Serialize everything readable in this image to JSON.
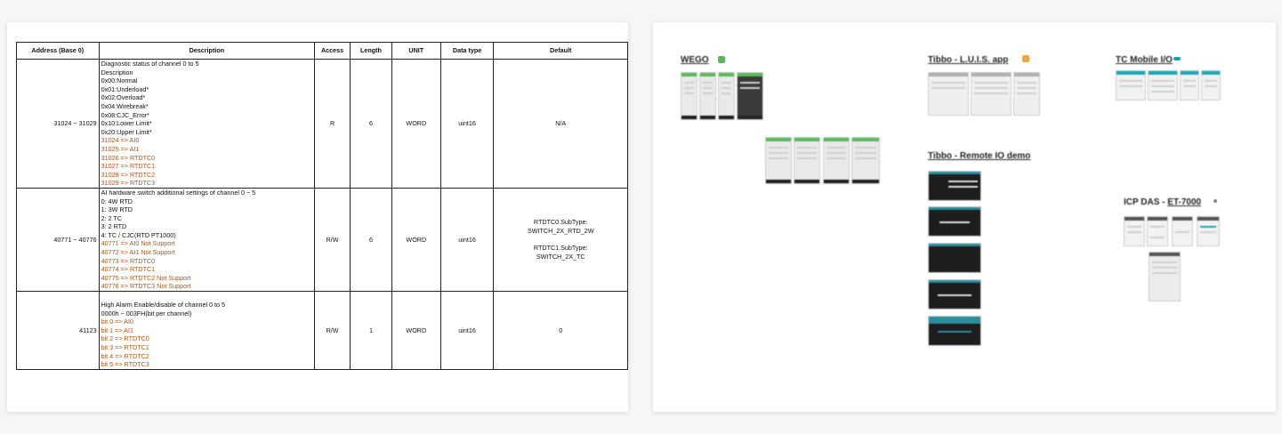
{
  "doc": {
    "headers": [
      "Address (Base 0)",
      "Description",
      "Access",
      "Length",
      "UNIT",
      "Data type",
      "Default"
    ],
    "rows": [
      {
        "address": "31024 ~ 31029",
        "desc": [
          {
            "t": "Diagnostic status of channel 0 to 5",
            "hl": false
          },
          {
            "t": "Description",
            "hl": false
          },
          {
            "t": "0x00:Normal",
            "hl": false
          },
          {
            "t": "0x01:Underload*",
            "hl": false
          },
          {
            "t": "0x02:Overload*",
            "hl": false
          },
          {
            "t": "0x04:Wirebreak*",
            "hl": false
          },
          {
            "t": "0x08:CJC_Error*",
            "hl": false
          },
          {
            "t": "0x10:Lower Limit*",
            "hl": false
          },
          {
            "t": "0x20:Upper Limit*",
            "hl": false
          },
          {
            "t": "31024 => AI0",
            "hl": true
          },
          {
            "t": "31025 => AI1",
            "hl": true
          },
          {
            "t": "31026 => RTDTC0",
            "hl": true
          },
          {
            "t": "31027 => RTDTC1",
            "hl": true
          },
          {
            "t": "31028 => RTDTC2",
            "hl": true
          },
          {
            "t": "31029 => RTDTC3",
            "hl": true
          }
        ],
        "access": "R",
        "length": "6",
        "unit": "WORD",
        "dtype": "uint16",
        "default": [
          "N/A"
        ]
      },
      {
        "address": "40771 ~ 40776",
        "desc": [
          {
            "t": "AI hardware switch additional settings of channel 0 ~ 5",
            "hl": false
          },
          {
            "t": "0: 4W RTD",
            "hl": false
          },
          {
            "t": "1: 3W RTD",
            "hl": false
          },
          {
            "t": "2: 2 TC",
            "hl": false
          },
          {
            "t": "3: 2 RTD",
            "hl": false
          },
          {
            "t": "4: TC / CJC(RTD PT1000)",
            "hl": false
          },
          {
            "t": "40771 => AI0 Not Support",
            "hl": true
          },
          {
            "t": "40772 => AI1 Not Support",
            "hl": true
          },
          {
            "t": "40773 => RTDTC0",
            "hl": true
          },
          {
            "t": "40774 => RTDTC1",
            "hl": true
          },
          {
            "t": "40775 => RTDTC2 Not Support",
            "hl": true
          },
          {
            "t": "40776 => RTDTC3 Not Support",
            "hl": true
          }
        ],
        "access": "R/W",
        "length": "6",
        "unit": "WORD",
        "dtype": "uint16",
        "default": [
          "RTDTC0.SubType:",
          "SWITCH_2X_RTD_2W",
          "",
          "RTDTC1.SubType:",
          "SWITCH_2X_TC"
        ]
      },
      {
        "address": "41123",
        "desc": [
          {
            "t": "",
            "hl": false
          },
          {
            "t": "High Alarm Enable/disable of channel 0 to 5",
            "hl": false
          },
          {
            "t": "0000h ~ 003FH(bit per channel)",
            "hl": false
          },
          {
            "t": "bit 0 => AI0",
            "hl": true
          },
          {
            "t": "bit 1 => AI1",
            "hl": true
          },
          {
            "t": "bit 2 => RTDTC0",
            "hl": true
          },
          {
            "t": "bit 3 => RTDTC1",
            "hl": true
          },
          {
            "t": "bit 4 => RTDTC2",
            "hl": true
          },
          {
            "t": "bit 5 => RTDTC3",
            "hl": true
          }
        ],
        "access": "R/W",
        "length": "1",
        "unit": "WORD",
        "dtype": "uint16",
        "default": [
          "0"
        ]
      }
    ]
  },
  "board": {
    "titles": {
      "wego": "WEGO",
      "luis": "Tibbo - L.U.I.S. app",
      "tcmobile": "TC Mobile I/O",
      "remoteio": "Tibbo - Remote IO demo",
      "icpdas_prefix": "ICP DAS - ",
      "icpdas_model": "ET-7000"
    },
    "accent_colors": {
      "green": "#5cb85c",
      "teal": "#19a6b5",
      "orange": "#f0a63a",
      "dark": "#1d1d1d"
    }
  }
}
